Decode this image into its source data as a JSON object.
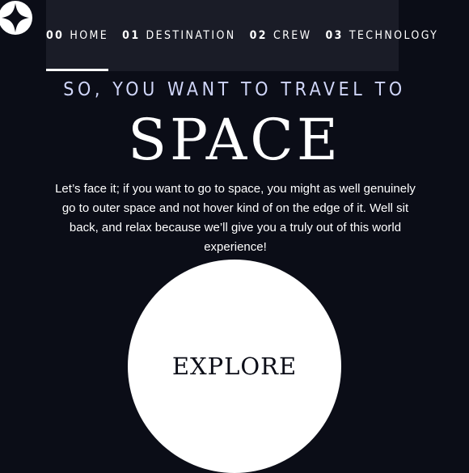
{
  "logo": {
    "icon": "star-logo-icon"
  },
  "nav": {
    "items": [
      {
        "num": "00",
        "label": "HOME",
        "active": true
      },
      {
        "num": "01",
        "label": "DESTINATION",
        "active": false
      },
      {
        "num": "02",
        "label": "CREW",
        "active": false
      },
      {
        "num": "03",
        "label": "TECHNOLOGY",
        "active": false
      }
    ]
  },
  "hero": {
    "kicker": "SO, YOU WANT TO TRAVEL TO",
    "title": "SPACE",
    "body": "Let’s face it; if you want to go to space, you might as well genuinely go to outer space and not hover kind of on the edge of it. Well sit back, and relax because we’ll give you a truly out of this world experience!",
    "cta_label": "EXPLORE"
  },
  "colors": {
    "background": "#0b0d17",
    "nav_background": "#1a1c27",
    "accent_text": "#d0d6f9",
    "white": "#ffffff"
  }
}
